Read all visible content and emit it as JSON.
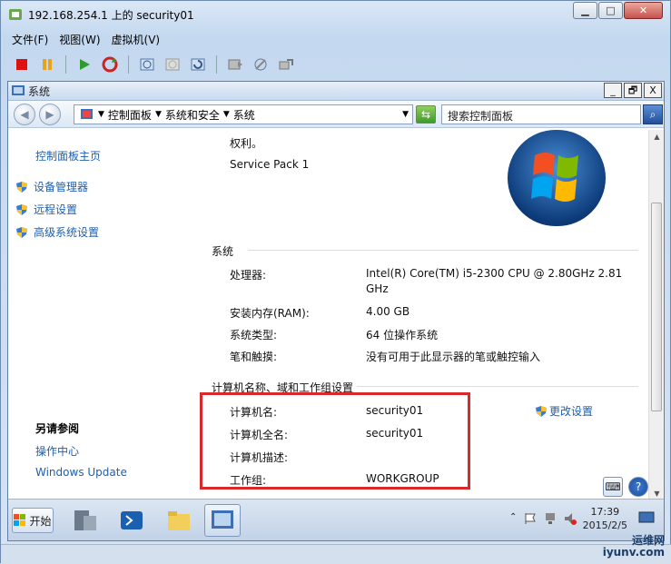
{
  "host_window": {
    "title": "192.168.254.1 上的 security01",
    "minimize": "▁",
    "maximize": "□",
    "close": "✕"
  },
  "menu": [
    "文件(F)",
    "视图(W)",
    "虚拟机(V)"
  ],
  "toolbar_icons": [
    "stop-icon",
    "pause-icon",
    "play-icon",
    "reset-icon",
    "snapshot-icon",
    "snapshot-disabled-icon",
    "revert-snapshot-icon",
    "save-state-icon",
    "settings-icon",
    "share-icon"
  ],
  "inner_window": {
    "title": "系统",
    "minimize": "_",
    "restore": "🗗",
    "close": "X"
  },
  "address": {
    "crumbs": [
      "控制面板",
      "系统和安全",
      "系统"
    ],
    "search_placeholder": "搜索控制面板"
  },
  "sidebar": {
    "home": "控制面板主页",
    "items": [
      {
        "label": "设备管理器"
      },
      {
        "label": "远程设置"
      },
      {
        "label": "高级系统设置"
      }
    ],
    "see_also_title": "另请参阅",
    "see_also": [
      "操作中心",
      "Windows Update"
    ]
  },
  "content": {
    "rights_text": "权利。",
    "service_pack": "Service Pack 1",
    "system_section": "系统",
    "system_rows": [
      {
        "label": "处理器:",
        "value": "Intel(R) Core(TM) i5-2300 CPU @ 2.80GHz   2.81",
        "value2": "GHz"
      },
      {
        "label": "安装内存(RAM):",
        "value": "4.00 GB"
      },
      {
        "label": "系统类型:",
        "value": "64 位操作系统"
      },
      {
        "label": "笔和触摸:",
        "value": "没有可用于此显示器的笔或触控输入"
      }
    ],
    "computer_section": "计算机名称、域和工作组设置",
    "computer_rows": [
      {
        "label": "计算机名:",
        "value": "security01"
      },
      {
        "label": "计算机全名:",
        "value": "security01"
      },
      {
        "label": "计算机描述:",
        "value": ""
      },
      {
        "label": "工作组:",
        "value": "WORKGROUP"
      }
    ],
    "change_settings": "更改设置"
  },
  "taskbar": {
    "start_label": "开始",
    "time": "17:39",
    "date": "2015/2/5"
  },
  "watermark": {
    "line1": "运维网",
    "line2": "iyunv.com"
  }
}
